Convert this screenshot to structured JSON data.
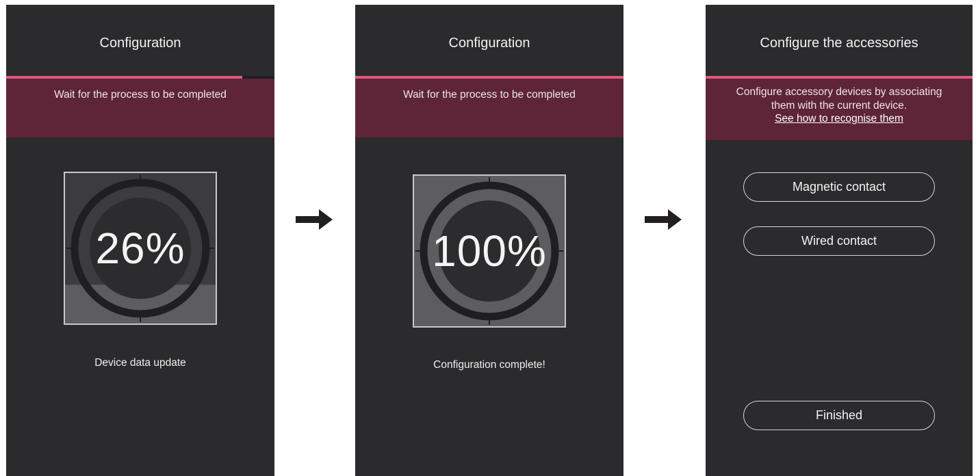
{
  "screen1": {
    "title": "Configuration",
    "progress": 0.88,
    "banner_text": "Wait for the process to be completed",
    "gauge_percent": 26,
    "gauge_label": "26%",
    "status": "Device data update"
  },
  "screen2": {
    "title": "Configuration",
    "progress": 1.0,
    "banner_text": "Wait for the process to be completed",
    "gauge_percent": 100,
    "gauge_label": "100%",
    "status": "Configuration complete!"
  },
  "screen3": {
    "title": "Configure the accessories",
    "banner_line1": "Configure accessory devices by associating",
    "banner_line2": "them with the current device.",
    "banner_link": "See how to recognise them",
    "buttons": {
      "magnetic": "Magnetic contact",
      "wired": "Wired contact",
      "finished": "Finished"
    }
  },
  "arrows": [
    "arrow-right-icon",
    "arrow-right-icon"
  ],
  "colors": {
    "screen_bg": "#2b2a2c",
    "banner_bg": "#5e2438",
    "accent": "#e0587f"
  }
}
